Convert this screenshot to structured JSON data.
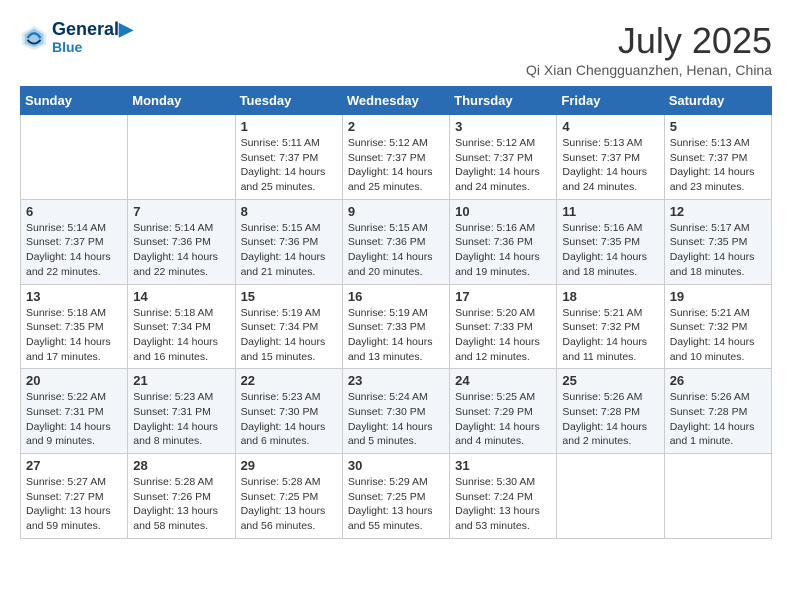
{
  "header": {
    "logo_line1": "General",
    "logo_line2": "Blue",
    "month_title": "July 2025",
    "location": "Qi Xian Chengguanzhen, Henan, China"
  },
  "days_of_week": [
    "Sunday",
    "Monday",
    "Tuesday",
    "Wednesday",
    "Thursday",
    "Friday",
    "Saturday"
  ],
  "weeks": [
    [
      {
        "day": "",
        "info": ""
      },
      {
        "day": "",
        "info": ""
      },
      {
        "day": "1",
        "info": "Sunrise: 5:11 AM\nSunset: 7:37 PM\nDaylight: 14 hours and 25 minutes."
      },
      {
        "day": "2",
        "info": "Sunrise: 5:12 AM\nSunset: 7:37 PM\nDaylight: 14 hours and 25 minutes."
      },
      {
        "day": "3",
        "info": "Sunrise: 5:12 AM\nSunset: 7:37 PM\nDaylight: 14 hours and 24 minutes."
      },
      {
        "day": "4",
        "info": "Sunrise: 5:13 AM\nSunset: 7:37 PM\nDaylight: 14 hours and 24 minutes."
      },
      {
        "day": "5",
        "info": "Sunrise: 5:13 AM\nSunset: 7:37 PM\nDaylight: 14 hours and 23 minutes."
      }
    ],
    [
      {
        "day": "6",
        "info": "Sunrise: 5:14 AM\nSunset: 7:37 PM\nDaylight: 14 hours and 22 minutes."
      },
      {
        "day": "7",
        "info": "Sunrise: 5:14 AM\nSunset: 7:36 PM\nDaylight: 14 hours and 22 minutes."
      },
      {
        "day": "8",
        "info": "Sunrise: 5:15 AM\nSunset: 7:36 PM\nDaylight: 14 hours and 21 minutes."
      },
      {
        "day": "9",
        "info": "Sunrise: 5:15 AM\nSunset: 7:36 PM\nDaylight: 14 hours and 20 minutes."
      },
      {
        "day": "10",
        "info": "Sunrise: 5:16 AM\nSunset: 7:36 PM\nDaylight: 14 hours and 19 minutes."
      },
      {
        "day": "11",
        "info": "Sunrise: 5:16 AM\nSunset: 7:35 PM\nDaylight: 14 hours and 18 minutes."
      },
      {
        "day": "12",
        "info": "Sunrise: 5:17 AM\nSunset: 7:35 PM\nDaylight: 14 hours and 18 minutes."
      }
    ],
    [
      {
        "day": "13",
        "info": "Sunrise: 5:18 AM\nSunset: 7:35 PM\nDaylight: 14 hours and 17 minutes."
      },
      {
        "day": "14",
        "info": "Sunrise: 5:18 AM\nSunset: 7:34 PM\nDaylight: 14 hours and 16 minutes."
      },
      {
        "day": "15",
        "info": "Sunrise: 5:19 AM\nSunset: 7:34 PM\nDaylight: 14 hours and 15 minutes."
      },
      {
        "day": "16",
        "info": "Sunrise: 5:19 AM\nSunset: 7:33 PM\nDaylight: 14 hours and 13 minutes."
      },
      {
        "day": "17",
        "info": "Sunrise: 5:20 AM\nSunset: 7:33 PM\nDaylight: 14 hours and 12 minutes."
      },
      {
        "day": "18",
        "info": "Sunrise: 5:21 AM\nSunset: 7:32 PM\nDaylight: 14 hours and 11 minutes."
      },
      {
        "day": "19",
        "info": "Sunrise: 5:21 AM\nSunset: 7:32 PM\nDaylight: 14 hours and 10 minutes."
      }
    ],
    [
      {
        "day": "20",
        "info": "Sunrise: 5:22 AM\nSunset: 7:31 PM\nDaylight: 14 hours and 9 minutes."
      },
      {
        "day": "21",
        "info": "Sunrise: 5:23 AM\nSunset: 7:31 PM\nDaylight: 14 hours and 8 minutes."
      },
      {
        "day": "22",
        "info": "Sunrise: 5:23 AM\nSunset: 7:30 PM\nDaylight: 14 hours and 6 minutes."
      },
      {
        "day": "23",
        "info": "Sunrise: 5:24 AM\nSunset: 7:30 PM\nDaylight: 14 hours and 5 minutes."
      },
      {
        "day": "24",
        "info": "Sunrise: 5:25 AM\nSunset: 7:29 PM\nDaylight: 14 hours and 4 minutes."
      },
      {
        "day": "25",
        "info": "Sunrise: 5:26 AM\nSunset: 7:28 PM\nDaylight: 14 hours and 2 minutes."
      },
      {
        "day": "26",
        "info": "Sunrise: 5:26 AM\nSunset: 7:28 PM\nDaylight: 14 hours and 1 minute."
      }
    ],
    [
      {
        "day": "27",
        "info": "Sunrise: 5:27 AM\nSunset: 7:27 PM\nDaylight: 13 hours and 59 minutes."
      },
      {
        "day": "28",
        "info": "Sunrise: 5:28 AM\nSunset: 7:26 PM\nDaylight: 13 hours and 58 minutes."
      },
      {
        "day": "29",
        "info": "Sunrise: 5:28 AM\nSunset: 7:25 PM\nDaylight: 13 hours and 56 minutes."
      },
      {
        "day": "30",
        "info": "Sunrise: 5:29 AM\nSunset: 7:25 PM\nDaylight: 13 hours and 55 minutes."
      },
      {
        "day": "31",
        "info": "Sunrise: 5:30 AM\nSunset: 7:24 PM\nDaylight: 13 hours and 53 minutes."
      },
      {
        "day": "",
        "info": ""
      },
      {
        "day": "",
        "info": ""
      }
    ]
  ]
}
